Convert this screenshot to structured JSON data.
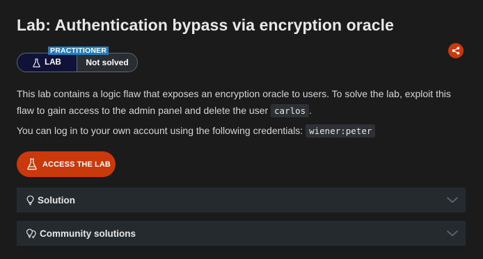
{
  "lab": {
    "title": "Lab: Authentication bypass via encryption oracle",
    "level": "PRACTITIONER",
    "badge_label": "LAB",
    "status": "Not solved"
  },
  "description": {
    "para1_text": "This lab contains a logic flaw that exposes an encryption oracle to users. To solve the lab, exploit this flaw to gain access to the admin panel and delete the user",
    "para1_code": "carlos",
    "para1_end": ".",
    "para2_text": "You can log in to your own account using the following credentials:",
    "para2_code": "wiener:peter"
  },
  "actions": {
    "access_label": "ACCESS THE LAB"
  },
  "sections": {
    "solution_label": "Solution",
    "community_label": "Community solutions"
  },
  "colors": {
    "accent": "#c9390b",
    "level_tag": "#1d7fc4",
    "badge_dark": "#101238",
    "panel": "#252a2e",
    "background": "#1b1b1b"
  },
  "icons": {
    "badge": "flask-icon",
    "share": "share-icon",
    "access": "flask-icon",
    "solution": "lightbulb-icon",
    "community": "community-bulbs-icon",
    "chevron": "chevron-down-icon"
  }
}
